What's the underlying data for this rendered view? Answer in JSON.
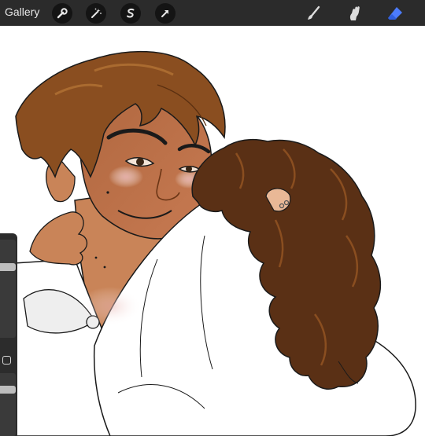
{
  "topbar": {
    "gallery_label": "Gallery",
    "left_tools": [
      "wrench-icon",
      "magic-wand-icon",
      "selection-icon",
      "transform-arrow-icon"
    ],
    "right_tools": [
      "brush-icon",
      "smudge-icon",
      "eraser-icon"
    ],
    "active_tool": "eraser-icon",
    "active_color": "#4c7cff"
  },
  "sidebar": {
    "brush_size_level": 0.3,
    "opacity_level": 0.55
  }
}
